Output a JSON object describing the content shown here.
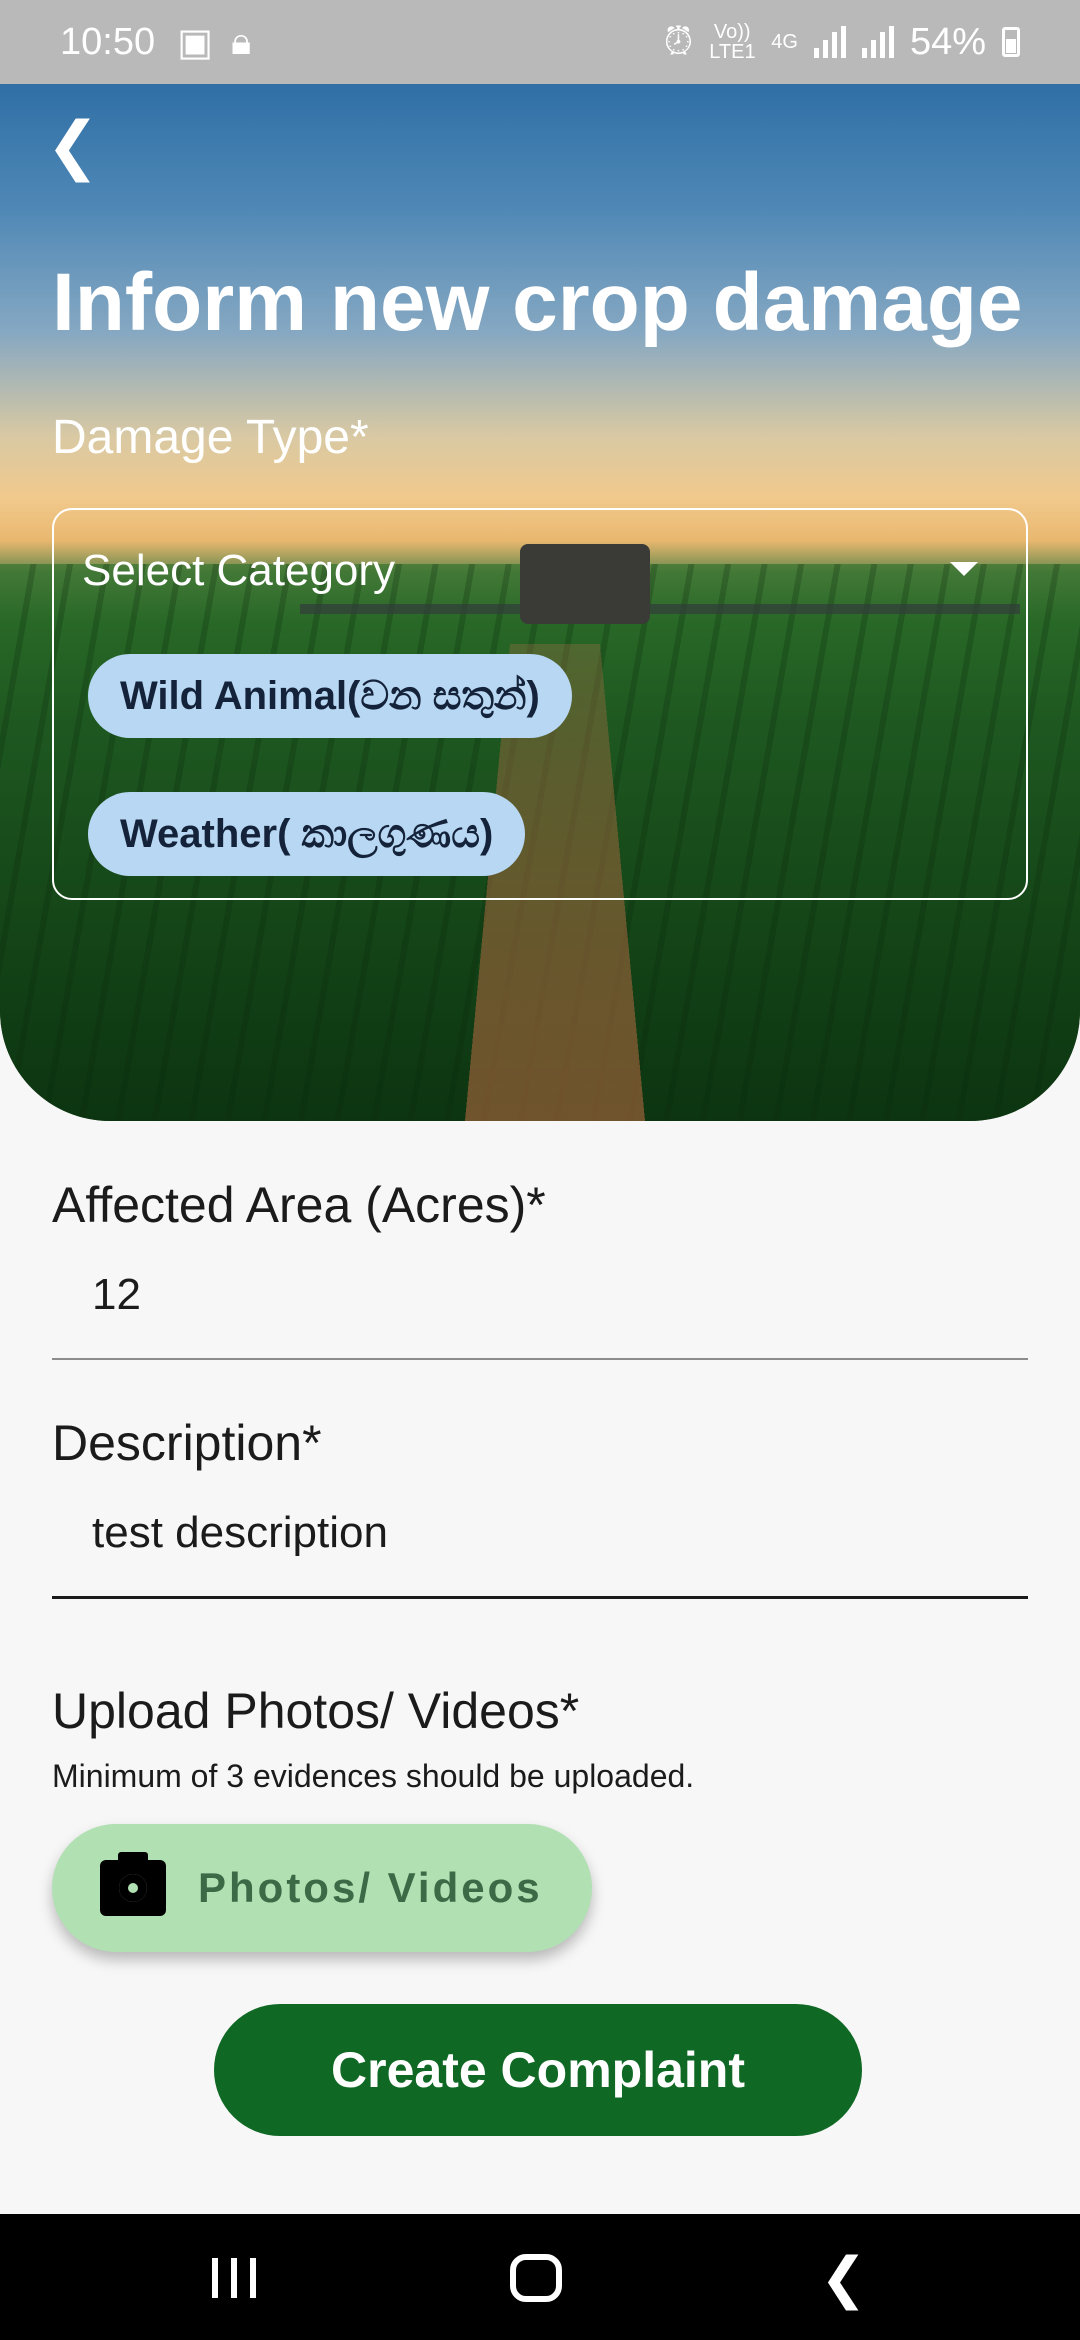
{
  "status_bar": {
    "time": "10:50",
    "network_label": "Vo)) LTE1",
    "network_type": "4G",
    "battery": "54%"
  },
  "header": {
    "title": "Inform new crop damage",
    "back_icon": "chevron-left-icon"
  },
  "damage_type": {
    "label": "Damage Type*",
    "placeholder": "Select Category",
    "chips": [
      "Wild Animal(වන සතුන්)",
      "Weather( කාලගුණය)"
    ]
  },
  "affected_area": {
    "label": "Affected Area (Acres)*",
    "value": "12"
  },
  "description": {
    "label": "Description*",
    "value": "test description"
  },
  "upload": {
    "label": "Upload Photos/ Videos*",
    "hint": "Minimum of 3 evidences should be uploaded.",
    "button_label": "Photos/ Videos",
    "icon": "camera-icon"
  },
  "submit": {
    "label": "Create Complaint"
  },
  "colors": {
    "chip_bg": "#b7d7f2",
    "upload_bg": "#b1e0b2",
    "primary": "#0f6824"
  }
}
